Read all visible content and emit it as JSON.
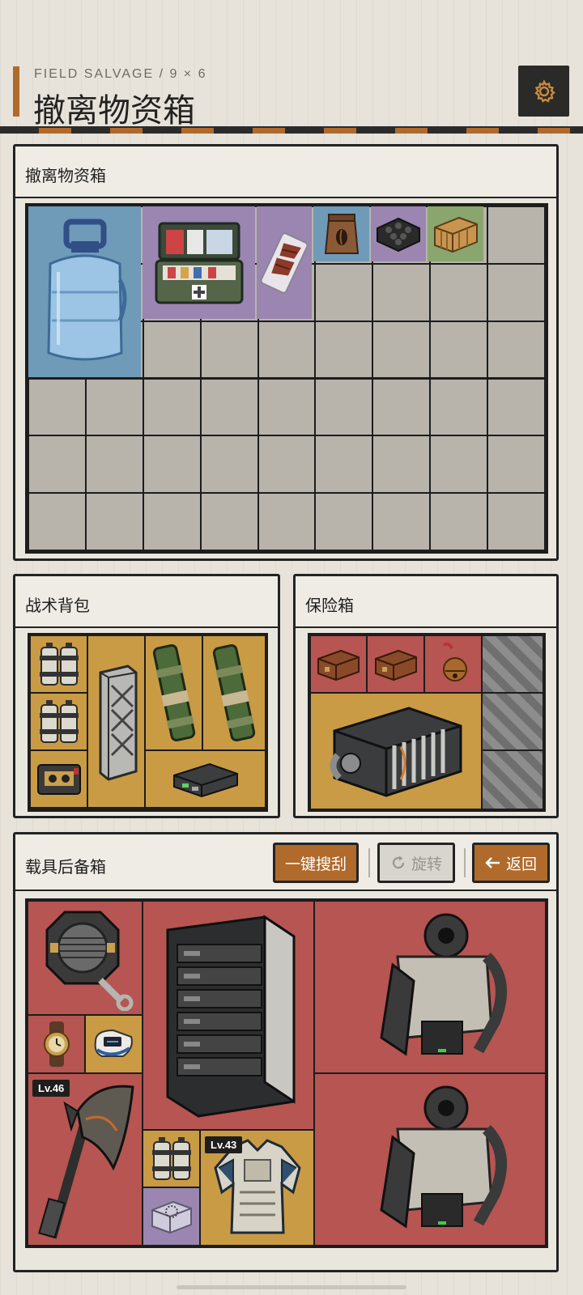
{
  "header": {
    "subtitle": "FIELD SALVAGE / 9 × 6",
    "title": "撤离物资箱",
    "settings_icon": "gear-icon"
  },
  "salvage_box": {
    "title": "撤离物资箱",
    "cols": 9,
    "rows": 6,
    "items": [
      {
        "name": "water-jug",
        "color": "#6f9ab8"
      },
      {
        "name": "medical-kit",
        "color": "#9a86b1"
      },
      {
        "name": "jerky-pack",
        "color": "#9a86b1"
      },
      {
        "name": "coffee-bag",
        "color": "#6f9ab8"
      },
      {
        "name": "ammo-tray",
        "color": "#9a86b1"
      },
      {
        "name": "supply-crate",
        "color": "#8aa56e"
      }
    ]
  },
  "backpack": {
    "title": "战术背包",
    "items": [
      {
        "name": "canister-pair"
      },
      {
        "name": "canister-pair"
      },
      {
        "name": "metal-case"
      },
      {
        "name": "green-tube"
      },
      {
        "name": "green-tube"
      },
      {
        "name": "cassette-device"
      },
      {
        "name": "circuit-box"
      }
    ]
  },
  "safe": {
    "title": "保险箱",
    "items": [
      {
        "name": "wooden-chest"
      },
      {
        "name": "wooden-chest"
      },
      {
        "name": "bell"
      },
      {
        "name": "engine-block"
      }
    ]
  },
  "vehicle_trunk": {
    "title": "载具后备箱",
    "buttons": {
      "loot_all": "一键搜刮",
      "rotate": "旋转",
      "back": "返回"
    },
    "levels": {
      "axe": "Lv.46",
      "armor": "Lv.43"
    },
    "items": [
      {
        "name": "cable-reel"
      },
      {
        "name": "server-rack"
      },
      {
        "name": "exoskeleton"
      },
      {
        "name": "wristwatch"
      },
      {
        "name": "pulse-oximeter"
      },
      {
        "name": "battle-axe"
      },
      {
        "name": "exoskeleton"
      },
      {
        "name": "canister-pair"
      },
      {
        "name": "body-armor"
      },
      {
        "name": "clear-box"
      }
    ]
  }
}
